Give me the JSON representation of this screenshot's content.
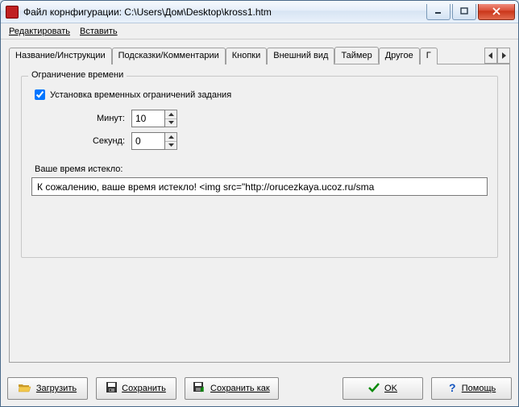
{
  "window": {
    "title": "Файл корнфигурации: C:\\Users\\Дом\\Desktop\\kross1.htm"
  },
  "menu": {
    "edit": "Редактировать",
    "insert": "Вставить"
  },
  "tabs": {
    "items": [
      {
        "label": "Название/Инструкции"
      },
      {
        "label": "Подсказки/Комментарии"
      },
      {
        "label": "Кнопки"
      },
      {
        "label": "Внешний вид"
      },
      {
        "label": "Таймер"
      },
      {
        "label": "Другое"
      },
      {
        "label": "Г"
      }
    ],
    "active_index": 4
  },
  "timer": {
    "group_title": "Ограничение времени",
    "checkbox_label": "Установка временных ограничений задания",
    "checkbox_checked": true,
    "minutes_label": "Минут:",
    "minutes_value": "10",
    "seconds_label": "Секунд:",
    "seconds_value": "0",
    "timeout_label": "Ваше время истекло:",
    "timeout_value": "К сожалению, ваше время истекло! <img src=\"http://orucezkaya.ucoz.ru/sma"
  },
  "buttons": {
    "load": "Загрузить",
    "save": "Сохранить",
    "save_as": "Сохранить как",
    "ok": "OK",
    "help": "Помощь"
  },
  "icons": {
    "folder_color": "#f2c84b",
    "floppy_color": "#333333",
    "check_color": "#0a8a0a",
    "help_color": "#1455c0"
  }
}
